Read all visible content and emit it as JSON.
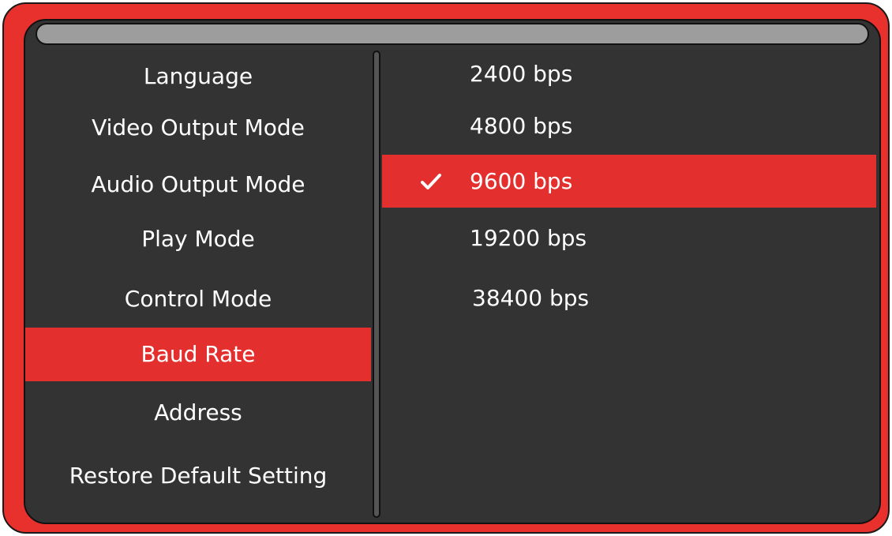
{
  "menu": {
    "items": [
      {
        "label": "Language"
      },
      {
        "label": "Video Output Mode"
      },
      {
        "label": "Audio Output Mode"
      },
      {
        "label": "Play Mode"
      },
      {
        "label": "Control Mode"
      },
      {
        "label": "Baud Rate",
        "selected": true
      },
      {
        "label": "Address"
      },
      {
        "label": "Restore Default Setting"
      }
    ]
  },
  "options": {
    "items": [
      {
        "label": "2400 bps"
      },
      {
        "label": "4800 bps"
      },
      {
        "label": "9600 bps",
        "selected": true,
        "checked": true
      },
      {
        "label": "19200 bps"
      },
      {
        "label": "38400 bps"
      }
    ]
  },
  "colors": {
    "frame": "#e8302c",
    "screen": "#333333",
    "highlight": "#e3302e",
    "title_bar": "#9d9d9d",
    "text": "#ffffff"
  },
  "icons": {
    "selected_option": "check-icon"
  }
}
